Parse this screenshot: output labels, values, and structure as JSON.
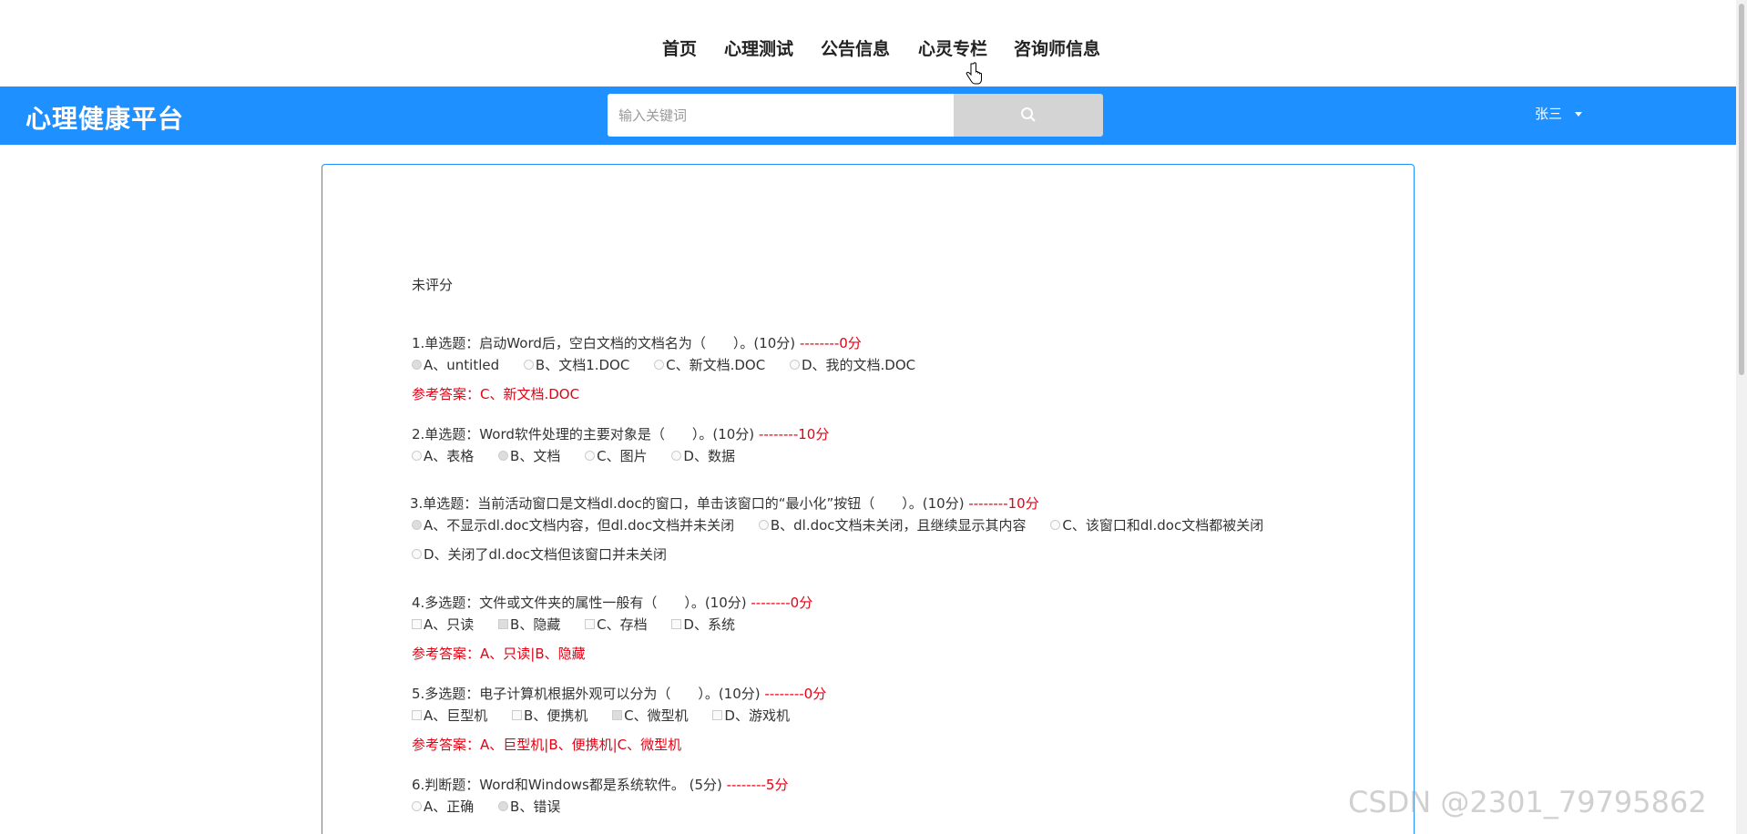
{
  "nav": {
    "items": [
      {
        "label": "首页"
      },
      {
        "label": "心理测试"
      },
      {
        "label": "公告信息"
      },
      {
        "label": "心灵专栏"
      },
      {
        "label": "咨询师信息"
      }
    ]
  },
  "header": {
    "logo": "心理健康平台",
    "search_placeholder": "输入关键词",
    "search_icon": "search-icon",
    "user_name": "张三",
    "bg_color": "#1e90ff"
  },
  "exam": {
    "status": "未评分",
    "questions": [
      {
        "title": "1.单选题：启动Word后，空白文档的文档名为（　　）。(10分)",
        "score": " --------0分",
        "type": "radio",
        "options": [
          {
            "label": "A、untitled",
            "selected": true
          },
          {
            "label": "B、文档1.DOC",
            "selected": false
          },
          {
            "label": "C、新文档.DOC",
            "selected": false
          },
          {
            "label": "D、我的文档.DOC",
            "selected": false
          }
        ],
        "answer": "参考答案：C、新文档.DOC"
      },
      {
        "title": "2.单选题：Word软件处理的主要对象是（　　）。(10分)",
        "score": " --------10分",
        "type": "radio",
        "options": [
          {
            "label": "A、表格",
            "selected": false
          },
          {
            "label": "B、文档",
            "selected": true
          },
          {
            "label": "C、图片",
            "selected": false
          },
          {
            "label": "D、数据",
            "selected": false
          }
        ]
      },
      {
        "title": "3.单选题：当前活动窗口是文档dl.doc的窗口，单击该窗口的“最小化”按钮（　　）。(10分)",
        "score": " --------10分",
        "type": "radio",
        "options": [
          {
            "label": "A、不显示dl.doc文档内容，但dl.doc文档并未关闭",
            "selected": true
          },
          {
            "label": "B、dl.doc文档未关闭，且继续显示其内容",
            "selected": false
          },
          {
            "label": "C、该窗口和dl.doc文档都被关闭",
            "selected": false
          }
        ],
        "options_line2": [
          {
            "label": "D、关闭了dl.doc文档但该窗口并未关闭",
            "selected": false
          }
        ]
      },
      {
        "title": "4.多选题：文件或文件夹的属性一般有（　　）。(10分)",
        "score": " --------0分",
        "type": "check",
        "options": [
          {
            "label": "A、只读",
            "selected": false
          },
          {
            "label": "B、隐藏",
            "selected": true
          },
          {
            "label": "C、存档",
            "selected": false
          },
          {
            "label": "D、系统",
            "selected": false
          }
        ],
        "answer": "参考答案：A、只读|B、隐藏"
      },
      {
        "title": "5.多选题：电子计算机根据外观可以分为（　　）。(10分)",
        "score": " --------0分",
        "type": "check",
        "options": [
          {
            "label": "A、巨型机",
            "selected": false
          },
          {
            "label": "B、便携机",
            "selected": false
          },
          {
            "label": "C、微型机",
            "selected": true
          },
          {
            "label": "D、游戏机",
            "selected": false
          }
        ],
        "answer": "参考答案：A、巨型机|B、便携机|C、微型机"
      },
      {
        "title": "6.判断题：Word和Windows都是系统软件。 (5分)",
        "score": " --------5分",
        "type": "radio",
        "options": [
          {
            "label": "A、正确",
            "selected": false
          },
          {
            "label": "B、错误",
            "selected": true
          }
        ]
      }
    ]
  },
  "watermark": "CSDN @2301_79795862",
  "colors": {
    "score_red": "#e60012",
    "accent_blue": "#1e90ff"
  }
}
